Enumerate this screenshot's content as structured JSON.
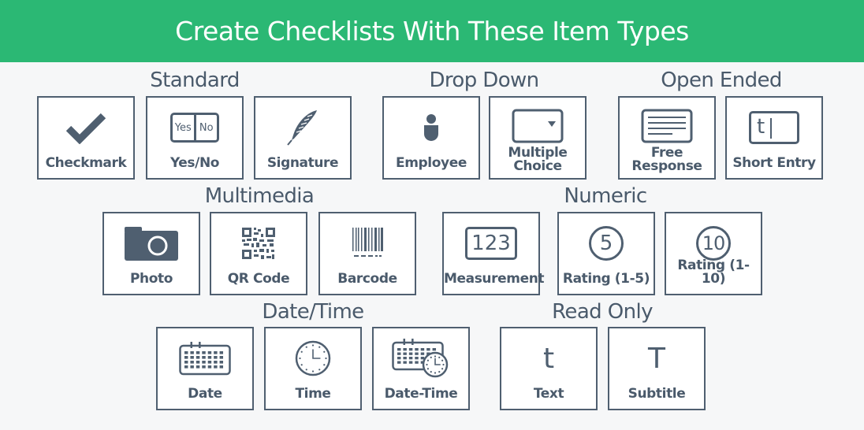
{
  "banner": {
    "title": "Create Checklists With These Item Types"
  },
  "colors": {
    "brand_green": "#2bb874",
    "slate": "#4f5f70",
    "background": "#f6f7f8"
  },
  "categories": {
    "standard": {
      "title": "Standard",
      "items": [
        {
          "label": "Checkmark",
          "icon": "checkmark-icon"
        },
        {
          "label": "Yes/No",
          "icon": "yes-no-toggle-icon",
          "icon_text_left": "Yes",
          "icon_text_right": "No"
        },
        {
          "label": "Signature",
          "icon": "feather-quill-icon"
        }
      ]
    },
    "dropdown": {
      "title": "Drop Down",
      "items": [
        {
          "label": "Employee",
          "icon": "person-icon"
        },
        {
          "label_line1": "Multiple",
          "label_line2": "Choice",
          "icon": "dropdown-select-icon"
        }
      ]
    },
    "open_ended": {
      "title": "Open Ended",
      "items": [
        {
          "label_line1": "Free",
          "label_line2": "Response",
          "icon": "text-area-icon"
        },
        {
          "label": "Short Entry",
          "icon": "text-input-icon",
          "icon_text": "t"
        }
      ]
    },
    "multimedia": {
      "title": "Multimedia",
      "items": [
        {
          "label": "Photo",
          "icon": "camera-icon"
        },
        {
          "label": "QR Code",
          "icon": "qr-code-icon"
        },
        {
          "label": "Barcode",
          "icon": "barcode-icon"
        }
      ]
    },
    "numeric": {
      "title": "Numeric",
      "items": [
        {
          "label": "Measurement",
          "icon": "number-field-icon",
          "icon_text": "123"
        },
        {
          "label": "Rating (1-5)",
          "icon": "rating-circle-icon",
          "icon_text": "5"
        },
        {
          "label": "Rating (1-10)",
          "icon": "rating-circle-icon",
          "icon_text": "10"
        }
      ]
    },
    "datetime": {
      "title": "Date/Time",
      "items": [
        {
          "label": "Date",
          "icon": "calendar-icon"
        },
        {
          "label": "Time",
          "icon": "clock-icon"
        },
        {
          "label": "Date-Time",
          "icon": "calendar-clock-icon"
        }
      ]
    },
    "read_only": {
      "title": "Read Only",
      "items": [
        {
          "label": "Text",
          "icon": "lowercase-t-icon",
          "icon_text": "t"
        },
        {
          "label": "Subtitle",
          "icon": "uppercase-t-icon",
          "icon_text": "T"
        }
      ]
    }
  }
}
